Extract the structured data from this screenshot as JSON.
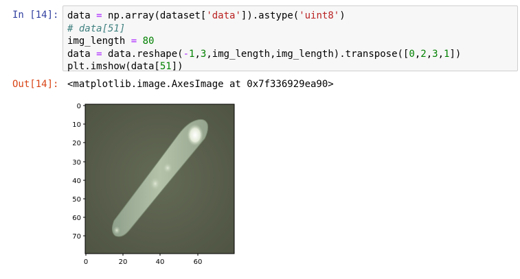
{
  "cell_in": {
    "prompt": "In [14]:",
    "lines": [
      "data = np.array(dataset['data']).astype('uint8')",
      "# data[51]",
      "img_length = 80",
      "data = data.reshape(-1,3,img_length,img_length).transpose([0,2,3,1])",
      "plt.imshow(data[51])"
    ]
  },
  "cell_out": {
    "prompt": "Out[14]:",
    "text": "<matplotlib.image.AxesImage at 0x7f336929ea90>"
  },
  "plot": {
    "y_ticks": [
      "0",
      "10",
      "20",
      "30",
      "40",
      "50",
      "60",
      "70"
    ],
    "x_ticks": [
      "0",
      "20",
      "40",
      "60"
    ],
    "colors": {
      "background": "#5a5f4a",
      "ship_body": "#a8b8a0",
      "ship_highlight": "#e8efe0"
    }
  }
}
